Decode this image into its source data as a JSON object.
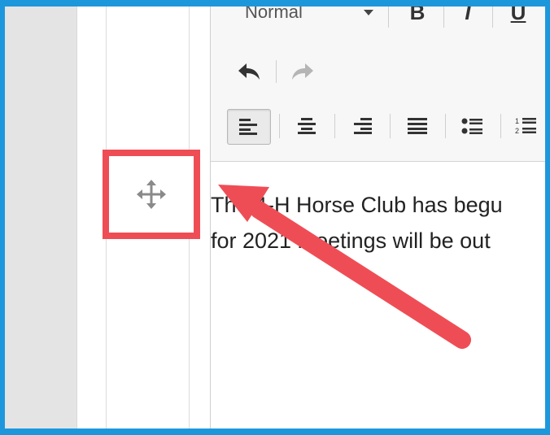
{
  "toolbar": {
    "style_select_value": "Normal",
    "bold_label": "B",
    "italic_label": "I",
    "underline_label": "U",
    "undo_icon": "undo-icon",
    "redo_icon": "redo-icon",
    "align_buttons": [
      "align-left-icon",
      "align-center-icon",
      "align-right-icon",
      "align-justify-icon",
      "bulleted-list-icon",
      "numbered-list-icon"
    ],
    "active_align": "align-left-icon"
  },
  "content": {
    "line1": "The 4-H Horse Club has begu",
    "line2": "for 2021 meetings will be out"
  },
  "drag_handle": {
    "icon": "move-icon"
  },
  "annotation": {
    "highlight_color": "#ef4d55",
    "arrow_color": "#ef4d55",
    "frame_color": "#1d97dc"
  }
}
